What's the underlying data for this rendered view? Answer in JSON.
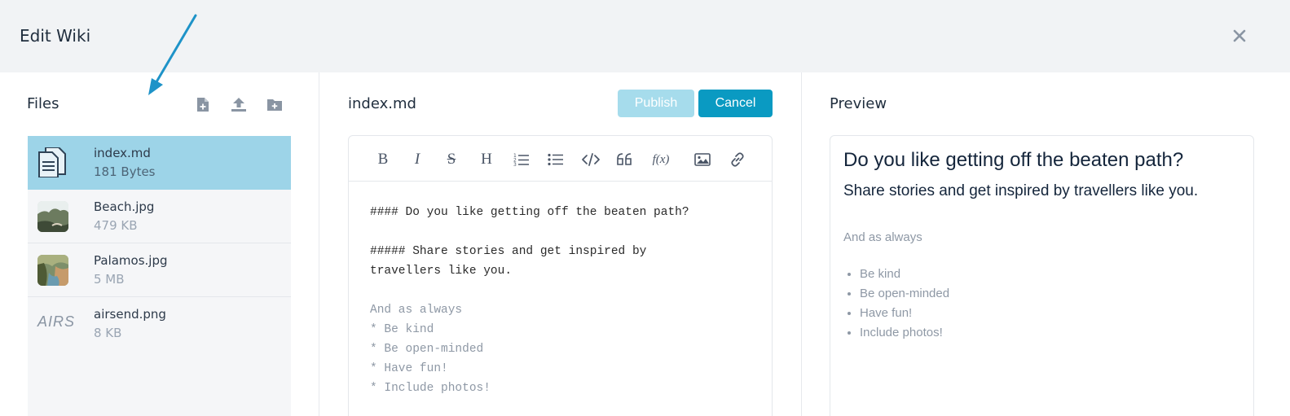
{
  "modal": {
    "title": "Edit Wiki"
  },
  "files": {
    "title": "Files",
    "items": [
      {
        "name": "index.md",
        "size": "181 Bytes",
        "icon": "document-icon",
        "selected": true
      },
      {
        "name": "Beach.jpg",
        "size": "479 KB",
        "icon": "image-thumbnail"
      },
      {
        "name": "Palamos.jpg",
        "size": "5 MB",
        "icon": "image-thumbnail"
      },
      {
        "name": "airsend.png",
        "size": "8 KB",
        "icon": "logo-thumbnail",
        "thumb_text": "AIRS"
      }
    ]
  },
  "editor": {
    "filename": "index.md",
    "publish_label": "Publish",
    "cancel_label": "Cancel",
    "toolbar": [
      "bold",
      "italic",
      "strikethrough",
      "heading",
      "ordered-list",
      "bullet-list",
      "code",
      "quote",
      "formula",
      "image",
      "link"
    ],
    "toolbar_labels": {
      "bold": "B",
      "italic": "I",
      "strike": "S",
      "heading": "H",
      "formula": "f(x)"
    },
    "lines": [
      "#### Do you like getting off the beaten path?",
      "",
      "##### Share stories and get inspired by",
      "travellers like you.",
      "",
      "And as always",
      "* Be kind",
      "* Be open-minded",
      "* Have fun!",
      "* Include photos!"
    ]
  },
  "preview": {
    "title": "Preview",
    "h4": "Do you like getting off the beaten path?",
    "h5": "Share stories and get inspired by travellers like you.",
    "paragraph": "And as always",
    "list": [
      "Be kind",
      "Be open-minded",
      "Have fun!",
      "Include photos!"
    ]
  },
  "colors": {
    "accent": "#0a9ac2",
    "accent_disabled": "#a6dcec",
    "selected_row": "#9dd4e8",
    "header_bg": "#f1f3f5"
  }
}
